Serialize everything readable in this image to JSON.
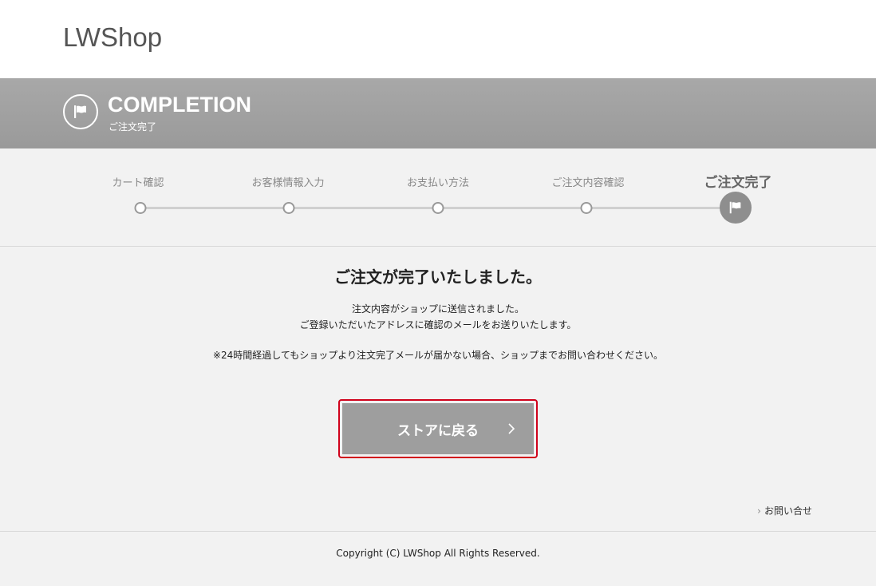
{
  "header": {
    "logo": "LWShop"
  },
  "banner": {
    "title": "COMPLETION",
    "subtitle": "ご注文完了",
    "icon": "flag-icon"
  },
  "steps": [
    {
      "label": "カート確認",
      "state": "done"
    },
    {
      "label": "お客様情報入力",
      "state": "done"
    },
    {
      "label": "お支払い方法",
      "state": "done"
    },
    {
      "label": "ご注文内容確認",
      "state": "done"
    },
    {
      "label": "ご注文完了",
      "state": "current"
    }
  ],
  "content": {
    "heading": "ご注文が完了いたしました。",
    "line1": "注文内容がショップに送信されました。",
    "line2": "ご登録いただいたアドレスに確認のメールをお送りいたします。",
    "note": "※24時間経過してもショップより注文完了メールが届かない場合、ショップまでお問い合わせください。",
    "back_button": "ストアに戻る",
    "inquiry_link": "お問い合せ"
  },
  "footer": {
    "copyright": "Copyright (C) LWShop All Rights Reserved."
  },
  "colors": {
    "banner": "#a1a1a1",
    "focus_ring": "#d0021b",
    "button": "#9e9e9e"
  }
}
